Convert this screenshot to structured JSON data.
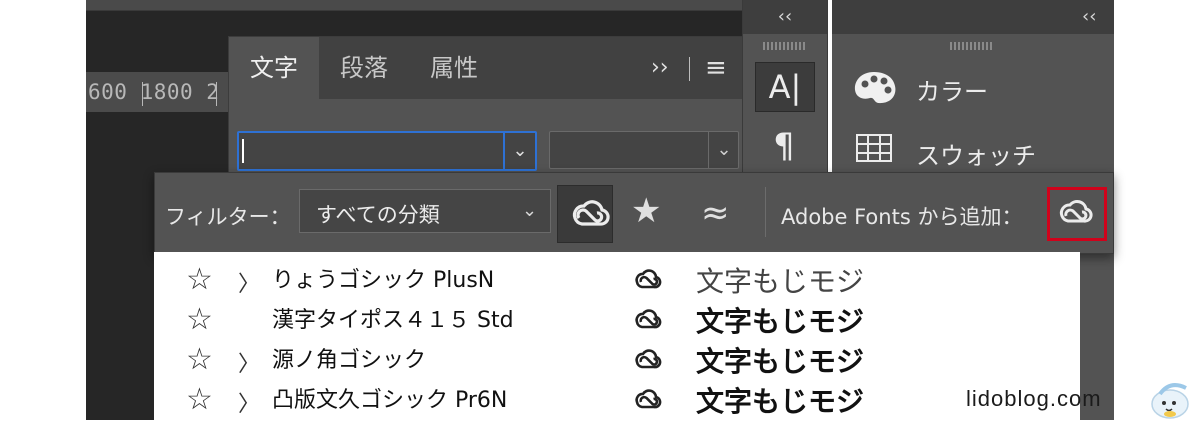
{
  "ruler": {
    "text": "600 1800 2"
  },
  "character_panel": {
    "tabs": [
      {
        "label": "文字",
        "active": true
      },
      {
        "label": "段落",
        "active": false
      },
      {
        "label": "属性",
        "active": false
      }
    ],
    "expand_glyph": "››",
    "menu_glyph": "≡",
    "font_family_value": "",
    "font_style_value": "",
    "dropdown_glyph": "⌄"
  },
  "icon_strip": {
    "collapse_glyph": "‹‹",
    "character_icon": "A|",
    "paragraph_icon": "¶"
  },
  "right_panel": {
    "collapse_glyph": "‹‹",
    "items": [
      {
        "label": "カラー",
        "icon": "palette-icon"
      },
      {
        "label": "スウォッチ",
        "icon": "swatch-grid-icon"
      }
    ]
  },
  "font_menu": {
    "filter_label": "フィルター：",
    "classification": {
      "selected": "すべての分類",
      "arrow": "⌄"
    },
    "star_glyph": "★",
    "similar_glyph": "≈",
    "adobe_fonts_label": "Adobe Fonts から追加：",
    "highlight_color": "#d0021b",
    "fonts": [
      {
        "name": "りょうゴシック PlusN",
        "has_children": true,
        "sample": "文字もじモジ",
        "weight": "light"
      },
      {
        "name": "漢字タイポス４１５ Std",
        "has_children": false,
        "sample": "文字もじモジ",
        "weight": "bold"
      },
      {
        "name": "源ノ角ゴシック",
        "has_children": true,
        "sample": "文字もじモジ",
        "weight": "mid"
      },
      {
        "name": "凸版文久ゴシック Pr6N",
        "has_children": true,
        "sample": "文字もじモジ",
        "weight": "mid"
      }
    ],
    "star_outline_glyph": "☆",
    "chevron_glyph": "〉"
  },
  "watermark": "lidoblog.com"
}
